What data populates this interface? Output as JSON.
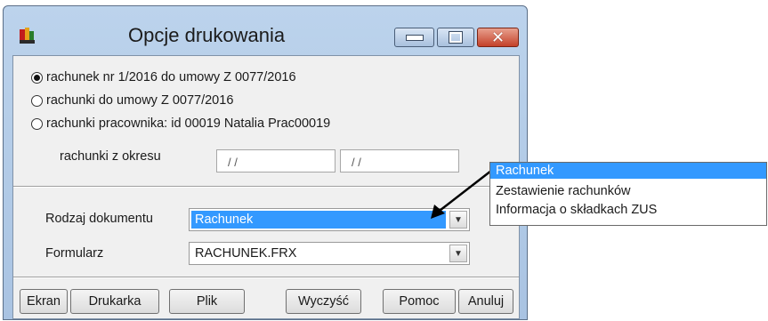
{
  "window": {
    "title": "Opcje drukowania"
  },
  "options": [
    {
      "label": "rachunek nr 1/2016 do umowy Z 0077/2016",
      "checked": true
    },
    {
      "label": "rachunki do umowy Z 0077/2016",
      "checked": false
    },
    {
      "label": "rachunki pracownika: id 00019 Natalia  Prac00019",
      "checked": false
    }
  ],
  "period": {
    "label": "rachunki z okresu",
    "from": "/ /",
    "to": "/ /"
  },
  "doc_type": {
    "label": "Rodzaj dokumentu",
    "value": "Rachunek"
  },
  "form": {
    "label": "Formularz",
    "value": "RACHUNEK.FRX"
  },
  "buttons": {
    "ekran": "Ekran",
    "drukarka": "Drukarka",
    "plik": "Plik",
    "wyczysc": "Wyczyść",
    "pomoc": "Pomoc",
    "anuluj": "Anuluj"
  },
  "dropdown": {
    "items": [
      "Rachunek",
      "Zestawienie rachunków",
      "Informacja o składkach ZUS"
    ],
    "selected": "Rachunek"
  },
  "colors": {
    "selection": "#3399ff",
    "titlebar": "#bcd3ec",
    "close_button": "#c4412a"
  }
}
